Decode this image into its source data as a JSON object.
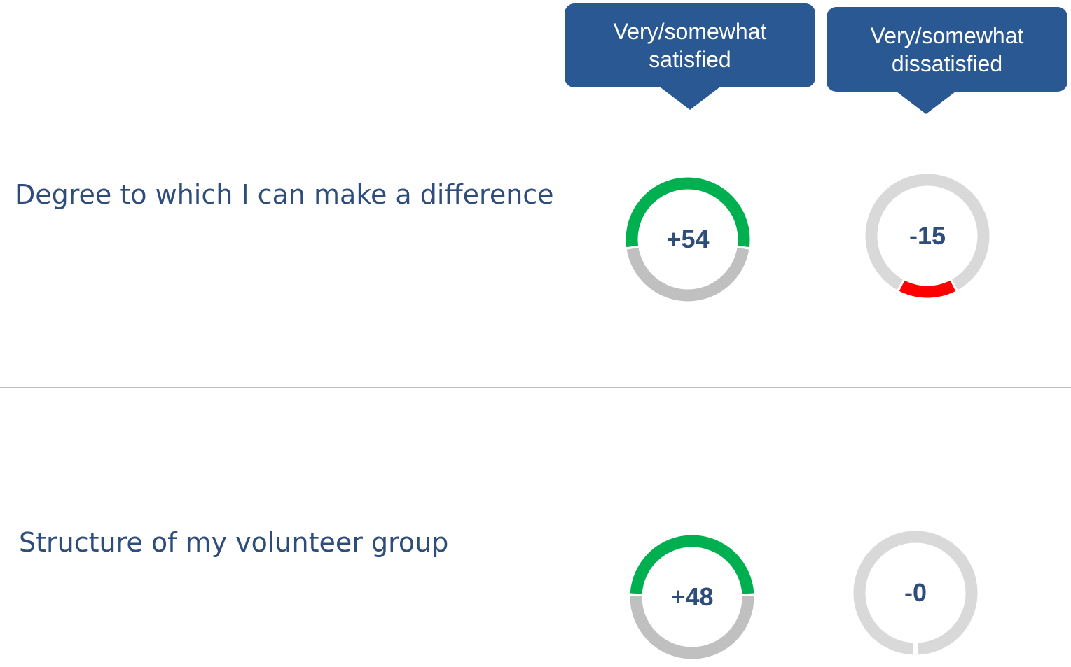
{
  "chart_data": {
    "type": "donut-gauges",
    "columns": [
      {
        "line1": "Very/somewhat",
        "line2": "satisfied"
      },
      {
        "line1": "Very/somewhat",
        "line2": "dissatisfied"
      }
    ],
    "rows": [
      {
        "label": "Degree to which I can make a difference",
        "gauges": [
          {
            "value": "+54",
            "score": 54,
            "color": "#00b050",
            "remainder_color": "#c0c0c0"
          },
          {
            "value": "-15",
            "score": -15,
            "color": "#ff0000",
            "remainder_color": "#d9d9d9"
          }
        ]
      },
      {
        "label": "Structure of my volunteer group",
        "gauges": [
          {
            "value": "+48",
            "score": 48,
            "color": "#00b050",
            "remainder_color": "#c0c0c0"
          },
          {
            "value": "-0",
            "score": 0,
            "color": "#ff0000",
            "remainder_color": "#d9d9d9"
          }
        ]
      }
    ]
  }
}
